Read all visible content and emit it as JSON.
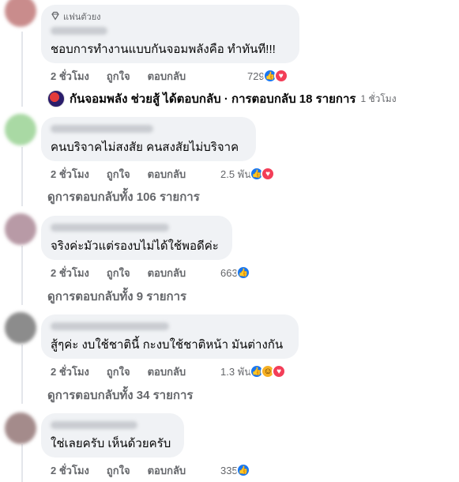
{
  "comments": [
    {
      "fan_badge": "แฟนตัวยง",
      "text": "ชอบการทำงานแบบกันจอมพลังคือ ทำทันที!!!",
      "time": "2 ชั่วโมง",
      "like_label": "ถูกใจ",
      "reply_label": "ตอบกลับ",
      "reaction_count": "729",
      "reactions": [
        "like-icon",
        "love-icon"
      ]
    },
    {
      "text": "คนบริจาคไม่สงสัย คนสงสัยไม่บริจาค",
      "time": "2 ชั่วโมง",
      "like_label": "ถูกใจ",
      "reply_label": "ตอบกลับ",
      "reaction_count": "2.5 พัน",
      "reactions": [
        "like-icon",
        "love-icon"
      ],
      "view_replies": "ดูการตอบกลับทั้ง 106 รายการ"
    },
    {
      "text": "จริงค่ะมัวแต่รองบไม่ได้ใช้พอดีค่ะ",
      "time": "2 ชั่วโมง",
      "like_label": "ถูกใจ",
      "reply_label": "ตอบกลับ",
      "reaction_count": "663",
      "reactions": [
        "like-icon"
      ],
      "view_replies": "ดูการตอบกลับทั้ง 9 รายการ"
    },
    {
      "text": "สู้ๆค่ะ งบใช้ชาตินี้ กะงบใช้ชาติหน้า มันต่างกัน",
      "time": "2 ชั่วโมง",
      "like_label": "ถูกใจ",
      "reply_label": "ตอบกลับ",
      "reaction_count": "1.3 พัน",
      "reactions": [
        "like-icon",
        "haha-icon",
        "love-icon"
      ],
      "view_replies": "ดูการตอบกลับทั้ง 34 รายการ"
    },
    {
      "text": "ใช่เลยครับ เห็นด้วยครับ",
      "time": "2 ชั่วโมง",
      "like_label": "ถูกใจ",
      "reply_label": "ตอบกลับ",
      "reaction_count": "335",
      "reactions": [
        "like-icon"
      ]
    }
  ],
  "reply_summary": {
    "text": "กันจอมพลัง ช่วยสู้ ได้ตอบกลับ · การตอบกลับ 18 รายการ",
    "time": "1 ชั่วโมง"
  },
  "colors": {
    "like": "#1877f2",
    "love": "#f33e58",
    "haha": "#f7b125",
    "bubble": "#f0f2f5",
    "meta_text": "#65676b"
  }
}
